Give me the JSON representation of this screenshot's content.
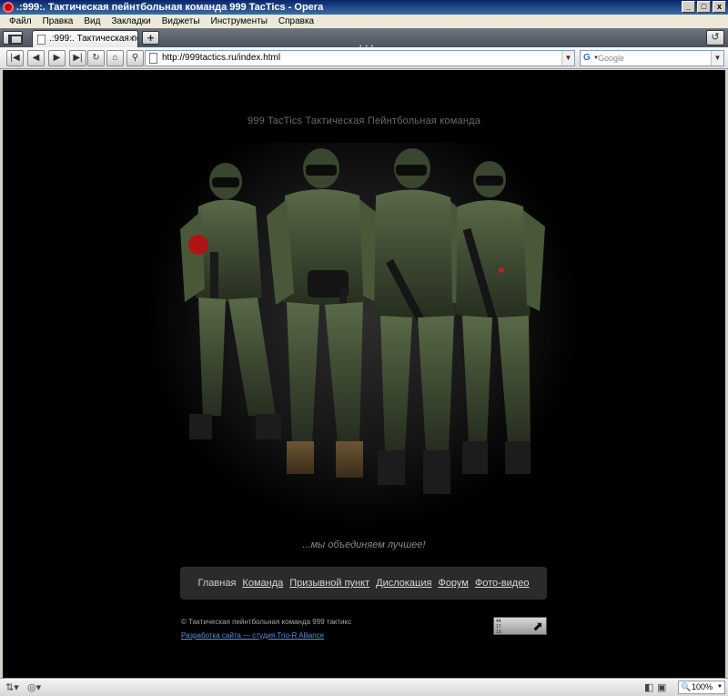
{
  "window": {
    "title": ".:999:. Тактическая пейнтбольная команда 999 TacTics - Opera",
    "minimize": "_",
    "maximize": "□",
    "close": "x"
  },
  "menubar": {
    "items": [
      "Файл",
      "Правка",
      "Вид",
      "Закладки",
      "Виджеты",
      "Инструменты",
      "Справка"
    ]
  },
  "tabs": {
    "active_tab_title": ".:999:. Тактическая пе...",
    "new_tab": "+"
  },
  "navbar": {
    "url": "http://999tactics.ru/index.html",
    "search_placeholder": "Google"
  },
  "site": {
    "title": "999 TacTics Тактическая Пейнтбольная команда",
    "slogan": "...мы объединяем лучшее!",
    "nav": [
      "Главная",
      "Команда",
      "Призывной пункт",
      "Дислокация",
      "Форум",
      "Фото-видео"
    ],
    "copyright": "© Тактическая пейнтбольная команда 999 тактикс",
    "developer_link": "Разработка сайта — студия Trio-R Alliance",
    "counter_text": "44 17 13"
  },
  "statusbar": {
    "zoom": "100%"
  },
  "colors": {
    "page_bg": "#000000",
    "menu_panel_bg": "#2b2b2b",
    "link": "#5b8fd8",
    "camo": "#4a5a3a"
  }
}
